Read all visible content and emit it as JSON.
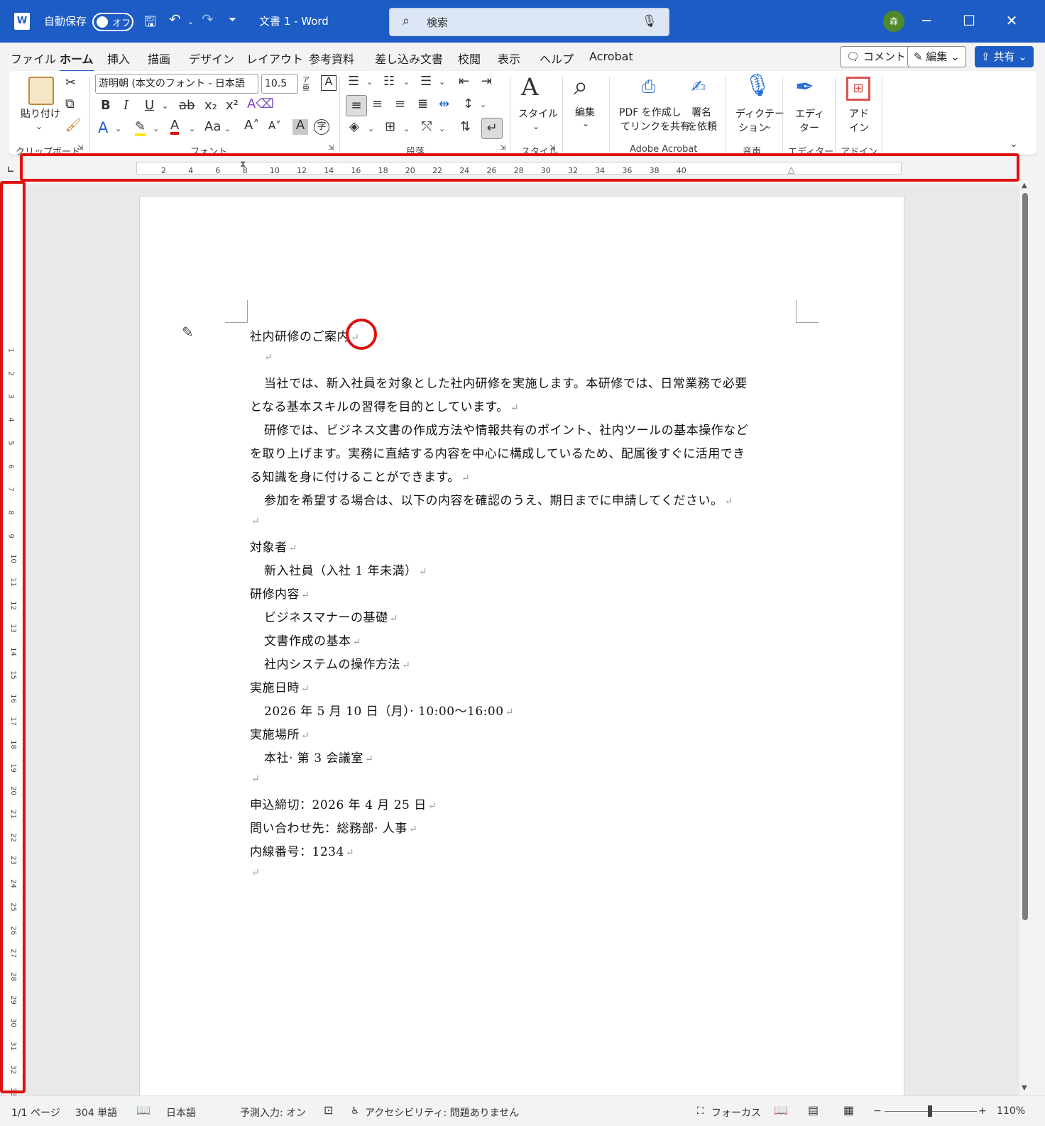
{
  "titlebar": {
    "autosave_label": "自動保存",
    "autosave_state": "オフ",
    "doc_title": "文書 1 - Word",
    "search_placeholder": "検索",
    "avatar_initial": "森"
  },
  "menu": {
    "tabs": [
      "ファイル",
      "ホーム",
      "挿入",
      "描画",
      "デザイン",
      "レイアウト",
      "参考資料",
      "差し込み文書",
      "校閲",
      "表示",
      "ヘルプ",
      "Acrobat"
    ],
    "comment_button": "コメント",
    "edit_button": "編集",
    "share_button": "共有"
  },
  "ribbon": {
    "paste_label": "貼り付け",
    "font_name": "游明朝 (本文のフォント - 日本語",
    "font_size": "10.5",
    "style_label": "スタイル",
    "edit_label": "編集",
    "pdf_label_1": "PDF を作成し",
    "pdf_label_2": "てリンクを共有",
    "sign_label_1": "署名",
    "sign_label_2": "を依頼",
    "dictation_label_1": "ディクテー",
    "dictation_label_2": "ション",
    "editor_label_1": "エディ",
    "editor_label_2": "ター",
    "addin_label_1": "アド",
    "addin_label_2": "イン",
    "groups": {
      "clipboard": "クリップボード",
      "font": "フォント",
      "paragraph": "段落",
      "styles": "スタイル",
      "acrobat": "Adobe Acrobat",
      "voice": "音声",
      "editor": "エディター",
      "addin": "アドイン"
    }
  },
  "ruler": {
    "h_numbers": [
      "2",
      "4",
      "6",
      "8",
      "10",
      "12",
      "14",
      "16",
      "18",
      "20",
      "22",
      "24",
      "26",
      "28",
      "30",
      "32",
      "34",
      "36",
      "38",
      "40"
    ],
    "v_numbers": [
      "1",
      "2",
      "3",
      "4",
      "5",
      "6",
      "7",
      "8",
      "9",
      "10",
      "11",
      "12",
      "13",
      "14",
      "15",
      "16",
      "17",
      "18",
      "19",
      "20",
      "21",
      "22",
      "23",
      "24",
      "25",
      "26",
      "27",
      "28",
      "29",
      "30",
      "31",
      "32",
      "33"
    ]
  },
  "document": {
    "title": "社内研修のご案内",
    "para1_line1": "当社では、新入社員を対象とした社内研修を実施します。本研修では、日常業務で必要",
    "para1_line2": "となる基本スキルの習得を目的としています。",
    "para2_line1": "研修では、ビジネス文書の作成方法や情報共有のポイント、社内ツールの基本操作など",
    "para2_line2": "を取り上げます。実務に直結する内容を中心に構成しているため、配属後すぐに活用でき",
    "para2_line3": "る知識を身に付けることができます。",
    "para3": "参加を希望する場合は、以下の内容を確認のうえ、期日までに申請してください。",
    "target_heading": "対象者",
    "target_value": "新入社員（入社 1 年未満）",
    "content_heading": "研修内容",
    "content_items": [
      "ビジネスマナーの基礎",
      "文書作成の基本",
      "社内システムの操作方法"
    ],
    "date_heading": "実施日時",
    "date_value": "2026 年 5 月 10 日（月）· 10:00～16:00",
    "place_heading": "実施場所",
    "place_value": "本社· 第 3 会議室",
    "deadline": "申込締切：2026 年 4 月 25 日",
    "contact": "問い合わせ先：総務部· 人事",
    "extension": "内線番号：1234",
    "para_mark": "↵"
  },
  "status": {
    "page": "1/1 ページ",
    "words": "304 単語",
    "language": "日本語",
    "predictive": "予測入力: オン",
    "accessibility": "アクセシビリティ: 問題ありません",
    "focus": "フォーカス",
    "zoom": "110%"
  },
  "colors": {
    "titlebar": "#1c5cc4",
    "highlight_red": "#e01010"
  }
}
